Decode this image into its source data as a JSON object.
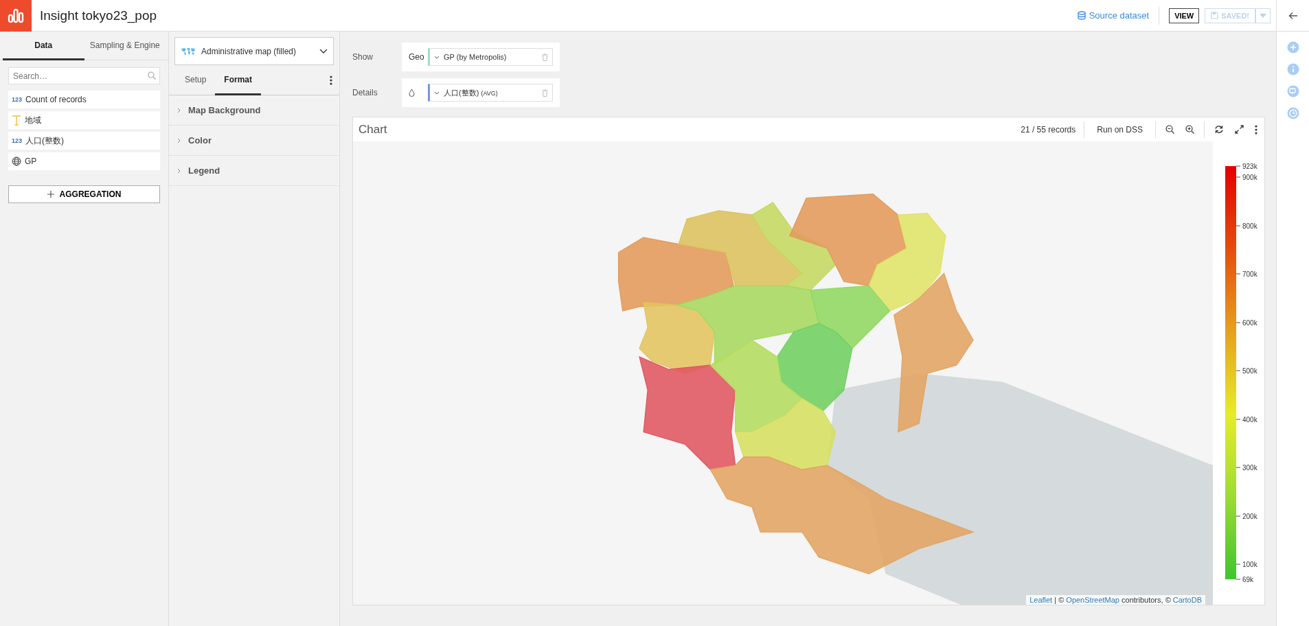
{
  "app": {
    "title": "Insight tokyo23_pop",
    "source_link": "Source dataset",
    "view_button": "VIEW",
    "saved_button": "SAVED!",
    "saved_disabled": true
  },
  "left_tabs": [
    {
      "label": "Data",
      "selected": true
    },
    {
      "label": "Sampling & Engine",
      "selected": false
    }
  ],
  "search": {
    "placeholder": "Search…"
  },
  "columns": [
    {
      "kind": "number",
      "type_label": "123",
      "name": "Count of records"
    },
    {
      "kind": "text",
      "name": "地域"
    },
    {
      "kind": "number",
      "type_label": "123",
      "name": "人口(整数)"
    },
    {
      "kind": "geo",
      "name": "GP"
    }
  ],
  "aggregation_button": "AGGREGATION",
  "chart_type": "Administrative map (filled)",
  "format_tabs": [
    {
      "label": "Setup",
      "selected": false
    },
    {
      "label": "Format",
      "selected": true
    }
  ],
  "format_sections": [
    {
      "label": "Map Background",
      "expanded": false
    },
    {
      "label": "Color",
      "expanded": false
    },
    {
      "label": "Legend",
      "expanded": false
    }
  ],
  "show": {
    "label": "Show",
    "slot_label": "Geo",
    "value": "GP (by Metropolis)"
  },
  "details": {
    "label": "Details",
    "value": "人口(整数)",
    "aggregation": "(AVG)"
  },
  "chart": {
    "title": "Chart",
    "records": "21 / 55 records",
    "run_button": "Run on DSS",
    "legend": {
      "top": "923k",
      "ticks": [
        "900k",
        "800k",
        "700k",
        "600k",
        "500k",
        "400k",
        "300k",
        "200k",
        "100k"
      ],
      "bottom": "69k"
    },
    "attribution": [
      {
        "text": "Leaflet",
        "link": true
      },
      {
        "text": "| ©",
        "link": false
      },
      {
        "text": "OpenStreetMap",
        "link": true
      },
      {
        "text": "contributors, ©",
        "link": false
      },
      {
        "text": "CartoDB",
        "link": true
      }
    ]
  }
}
